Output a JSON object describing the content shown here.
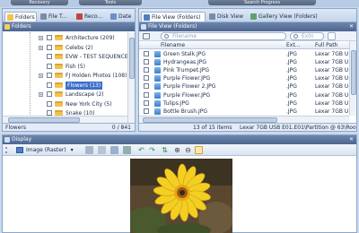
{
  "top_tabs": [
    "Recovery",
    "Tools",
    "Search Progress"
  ],
  "left_tabs": [
    "Folders",
    "File T...",
    "Reco...",
    "Date"
  ],
  "folders_header": "Folders",
  "tree_items": [
    {
      "label": "Architecture (209)",
      "expander": "+",
      "selected": false
    },
    {
      "label": "Celebs (2)",
      "expander": "+",
      "selected": false
    },
    {
      "label": "EVW - TEST SEQUENCE (6)",
      "expander": "",
      "selected": false
    },
    {
      "label": "Fish (5)",
      "expander": "",
      "selected": false
    },
    {
      "label": "FJ Holden Photos (108)",
      "expander": "+",
      "selected": false
    },
    {
      "label": "Flowers (13)",
      "expander": "",
      "selected": true
    },
    {
      "label": "Landscape (2)",
      "expander": "+",
      "selected": false
    },
    {
      "label": "New York City (5)",
      "expander": "",
      "selected": false
    },
    {
      "label": "Snake (10)",
      "expander": "",
      "selected": false
    }
  ],
  "left_status": {
    "name": "Flowers",
    "count": "0 / 841"
  },
  "right_tabs": [
    "File View (Folders)",
    "Disk View",
    "Gallery View (Folders)"
  ],
  "file_view_header": "File View (Folders)",
  "search": {
    "filename_placeholder": "Filename",
    "ext_placeholder": "Extn"
  },
  "columns": {
    "filename": "Filename",
    "ext": "Ext...",
    "path": "Full Path"
  },
  "files": [
    {
      "name": "Green Stalk.JPG",
      "ext": ".JPG",
      "path": "Lexar 7GB U"
    },
    {
      "name": "Hydrangeas.JPG",
      "ext": ".JPG",
      "path": "Lexar 7GB U"
    },
    {
      "name": "Pink Trumpet.JPG",
      "ext": ".JPG",
      "path": "Lexar 7GB U"
    },
    {
      "name": "Purple Flower.JPG",
      "ext": ".JPG",
      "path": "Lexar 7GB U"
    },
    {
      "name": "Purple Flower 2.JPG",
      "ext": ".JPG",
      "path": "Lexar 7GB U"
    },
    {
      "name": "Purple Flower.JPG",
      "ext": ".JPG",
      "path": "Lexar 7GB U"
    },
    {
      "name": "Tulips.JPG",
      "ext": ".JPG",
      "path": "Lexar 7GB U"
    },
    {
      "name": "Bottle Brush.JPG",
      "ext": ".JPG",
      "path": "Lexar 7GB U"
    }
  ],
  "right_status": {
    "count": "13 of 15 items",
    "path": "Lexar 7GB USB E01.E01\\Partition @ 63\\Roo"
  },
  "display_header": "Display",
  "image_selector": "Image (Raster)",
  "icons": {
    "folder": "folder-icon",
    "file": "jpg-file-icon",
    "search": "search-icon",
    "close": "close-icon"
  },
  "colors": {
    "header": "#5a74a0",
    "selection": "#3d6fc9",
    "folder": "#f2c24f",
    "accent_active": "#fde9a9"
  }
}
